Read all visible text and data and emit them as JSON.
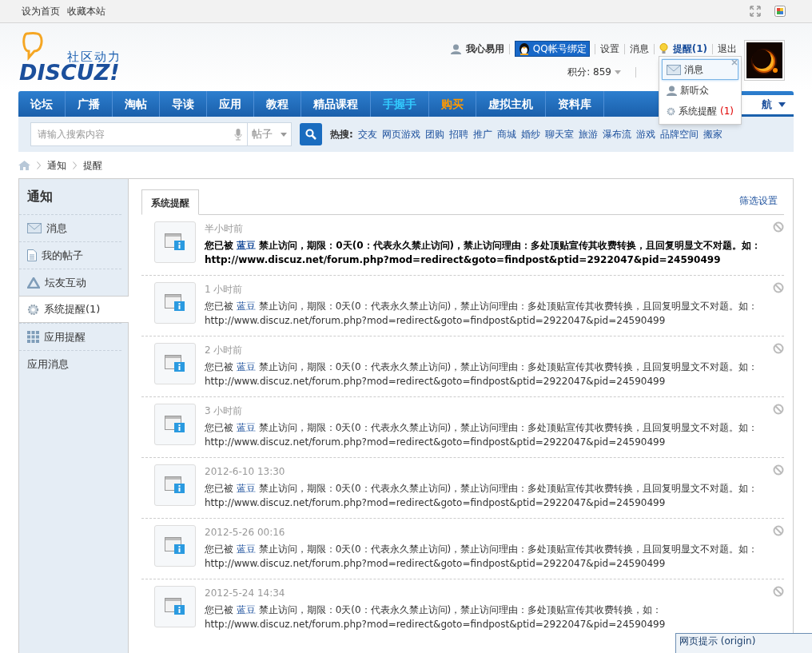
{
  "top_links": [
    "设为首页",
    "收藏本站"
  ],
  "logo": {
    "slogan": "社区动力",
    "wordmark": "DISCUZ!"
  },
  "user": {
    "name": "我心易用",
    "qq_button": "QQ帐号绑定",
    "links": [
      "设置",
      "消息"
    ],
    "remind": "提醒(1)",
    "logout": "退出",
    "score": "积分: 859"
  },
  "reminder_menu": [
    {
      "label": "消息",
      "selected": true
    },
    {
      "label": "新听众",
      "selected": false
    },
    {
      "label": "系统提醒",
      "count": "(1)",
      "selected": false
    }
  ],
  "nav": [
    {
      "label": "论坛",
      "color": "#ffffff"
    },
    {
      "label": "广播",
      "color": "#ffffff"
    },
    {
      "label": "淘帖",
      "color": "#ffffff"
    },
    {
      "label": "导读",
      "color": "#ffffff"
    },
    {
      "label": "应用",
      "color": "#ffffff"
    },
    {
      "label": "教程",
      "color": "#ffffff"
    },
    {
      "label": "精品课程",
      "color": "#ffffff"
    },
    {
      "label": "手握手",
      "color": "#33ccff"
    },
    {
      "label": "购买",
      "color": "#ff9900"
    },
    {
      "label": "虚拟主机",
      "color": "#ffffff"
    },
    {
      "label": "资料库",
      "color": "#ffffff"
    }
  ],
  "nav_right": "航",
  "search": {
    "placeholder": "请输入搜索内容",
    "scope": "帖子",
    "hot_label": "热搜:",
    "hot": [
      "交友",
      "网页游戏",
      "团购",
      "招聘",
      "推广",
      "商城",
      "婚纱",
      "聊天室",
      "旅游",
      "瀑布流",
      "游戏",
      "品牌空间",
      "搬家"
    ]
  },
  "breadcrumb": [
    "通知",
    "提醒"
  ],
  "sidebar": {
    "title": "通知",
    "items": [
      {
        "label": "消息",
        "selected": false
      },
      {
        "label": "我的帖子",
        "selected": false
      },
      {
        "label": "坛友互动",
        "selected": false
      },
      {
        "label": "系统提醒(1)",
        "selected": true
      },
      {
        "label": "应用提醒",
        "selected": false
      },
      {
        "label": "应用消息",
        "selected": false
      }
    ]
  },
  "tabs": [
    {
      "label": "系统提醒",
      "selected": true
    }
  ],
  "filter_link": "筛选设置",
  "notices": [
    {
      "time": "半小时前",
      "unread": true,
      "prefix": "您已被",
      "link": "蓝豆",
      "text": "禁止访问，期限：0天(0：代表永久禁止访问)，禁止访问理由：多处顶贴宣传其收费转换，且回复明显文不对题。如：",
      "url": "http://www.discuz.net/forum.php?mod=redirect&goto=findpost&ptid=2922047&pid=24590499"
    },
    {
      "time": "1 小时前",
      "unread": false,
      "prefix": "您已被",
      "link": "蓝豆",
      "text": "禁止访问，期限：0天(0：代表永久禁止访问)，禁止访问理由：多处顶贴宣传其收费转换，且回复明显文不对题。如：",
      "url": "http://www.discuz.net/forum.php?mod=redirect&goto=findpost&ptid=2922047&pid=24590499"
    },
    {
      "time": "2 小时前",
      "unread": false,
      "prefix": "您已被",
      "link": "蓝豆",
      "text": "禁止访问，期限：0天(0：代表永久禁止访问)，禁止访问理由：多处顶贴宣传其收费转换，且回复明显文不对题。如：",
      "url": "http://www.discuz.net/forum.php?mod=redirect&goto=findpost&ptid=2922047&pid=24590499"
    },
    {
      "time": "3 小时前",
      "unread": false,
      "prefix": "您已被",
      "link": "蓝豆",
      "text": "禁止访问，期限：0天(0：代表永久禁止访问)，禁止访问理由：多处顶贴宣传其收费转换，且回复明显文不对题。如：",
      "url": "http://www.discuz.net/forum.php?mod=redirect&goto=findpost&ptid=2922047&pid=24590499"
    },
    {
      "time": "2012-6-10 13:30",
      "unread": false,
      "prefix": "您已被",
      "link": "蓝豆",
      "text": "禁止访问，期限：0天(0：代表永久禁止访问)，禁止访问理由：多处顶贴宣传其收费转换，且回复明显文不对题。如：",
      "url": "http://www.discuz.net/forum.php?mod=redirect&goto=findpost&ptid=2922047&pid=24590499"
    },
    {
      "time": "2012-5-26 00:16",
      "unread": false,
      "prefix": "您已被",
      "link": "蓝豆",
      "text": "禁止访问，期限：0天(0：代表永久禁止访问)，禁止访问理由：多处顶贴宣传其收费转换，且回复明显文不对题。如：",
      "url": "http://www.discuz.net/forum.php?mod=redirect&goto=findpost&ptid=2922047&pid=24590499"
    },
    {
      "time": "2012-5-24 14:34",
      "unread": false,
      "prefix": "您已被",
      "link": "蓝豆",
      "text": "禁止访问，期限：0天(0：代表永久禁止访问)，禁止访问理由：多处顶贴宣传其收费转换，如：",
      "url": "http://www.discuz.net/forum.php?mod=redirect&goto=findpost&ptid=2922047&pid=24590499"
    }
  ],
  "browser_tip": "网页提示 (origin)"
}
